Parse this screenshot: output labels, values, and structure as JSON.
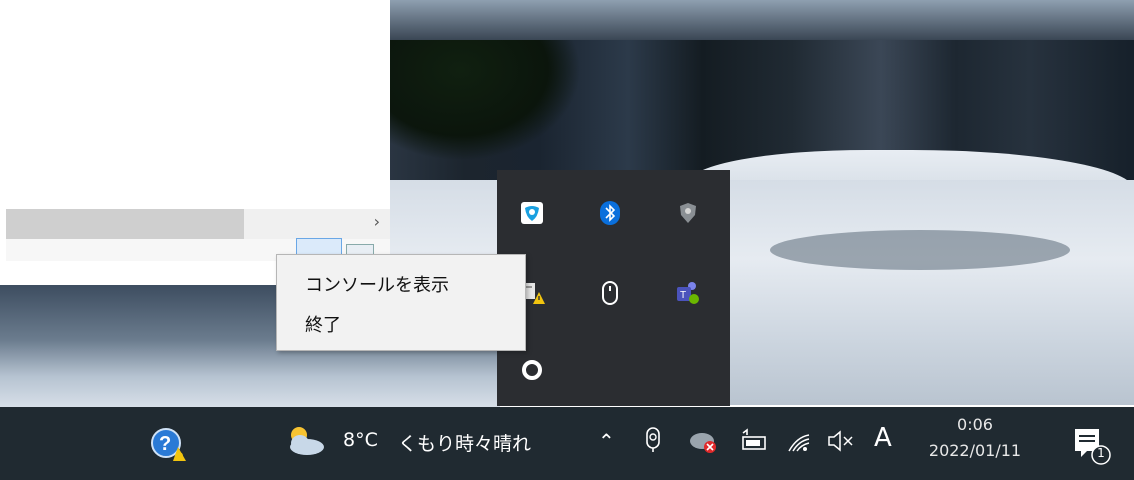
{
  "context_menu": {
    "items": [
      "コンソールを表示",
      "終了"
    ]
  },
  "taskbar": {
    "weather": {
      "temperature": "8°C",
      "condition": "くもり時々晴れ"
    },
    "input_indicator": "A",
    "clock": {
      "time": "0:06",
      "date": "2022/01/11"
    },
    "notification_count": "1"
  },
  "tray_overflow": {
    "icons": [
      "shield-app-icon",
      "bluetooth-icon",
      "antivirus-icon",
      "network-warning-icon",
      "mouse-icon",
      "teams-icon",
      "circle-app-icon"
    ]
  },
  "colors": {
    "taskbar_bg": "#202a31",
    "tray_bg": "#2b2d31",
    "menu_bg": "#f2f2f2",
    "accent_blue": "#0a6fdc"
  }
}
